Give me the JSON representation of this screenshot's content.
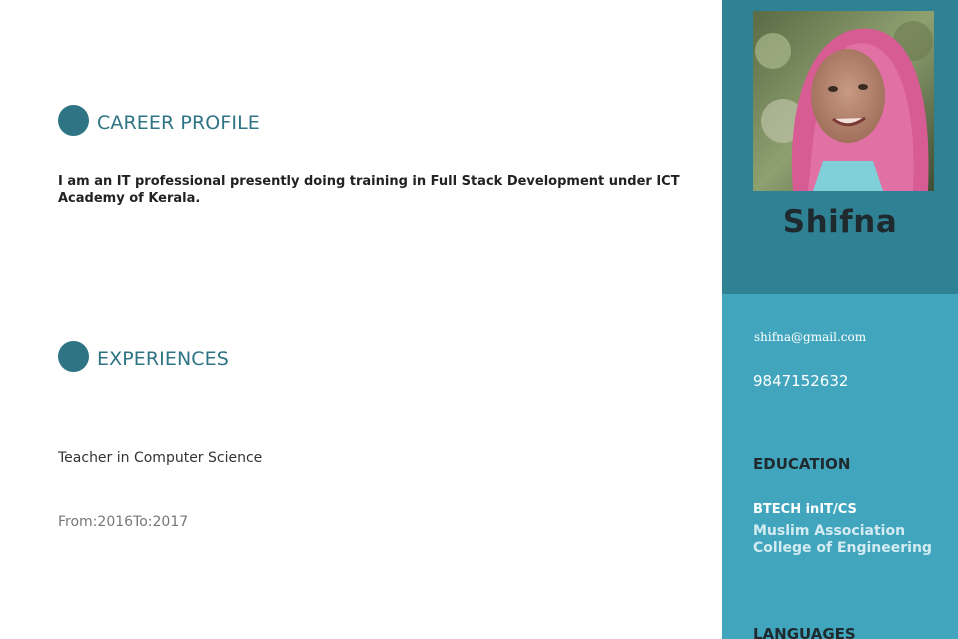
{
  "main": {
    "career": {
      "icon": "",
      "title": "CAREER PROFILE",
      "text": "I am an IT professional presently doing training in Full Stack Development under ICT Academy of Kerala."
    },
    "experiences": {
      "icon": "",
      "title": "EXPERIENCES",
      "job_title": "Teacher in Computer Science",
      "from_label": "From:",
      "from": "2016",
      "to_label": "To:",
      "to": "2017"
    }
  },
  "sidebar": {
    "name": "Shifna",
    "email_icon": "",
    "email": "shifna@gmail.com",
    "phone": "9847152632",
    "education": {
      "heading": "EDUCATION",
      "degree": "BTECH inIT/CS",
      "college": "Muslim Association College of Engineering"
    },
    "languages": {
      "heading": "LANGUAGES"
    }
  },
  "colors": {
    "accent": "#2e7484",
    "sidebar_top": "#2e8293",
    "sidebar_bottom": "#41a6bd"
  },
  "icons": {
    "career": "user-icon",
    "experiences": "briefcase-icon",
    "email": "envelope-icon"
  }
}
